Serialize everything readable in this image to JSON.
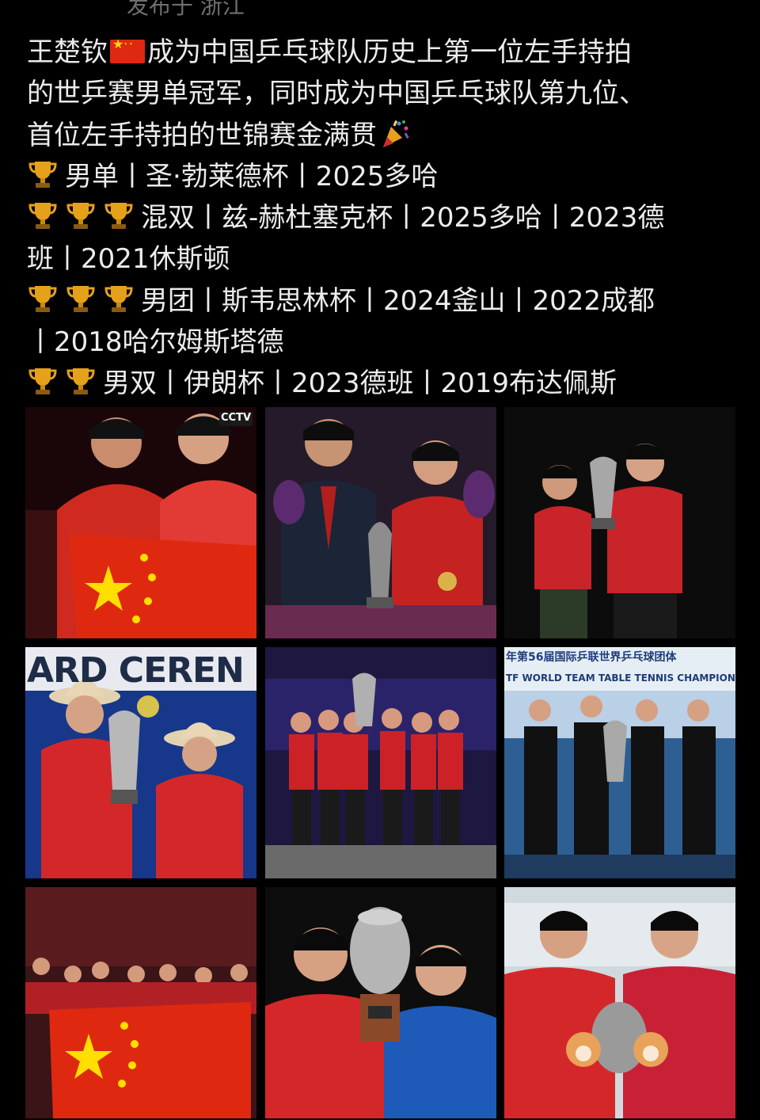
{
  "header": {
    "top_text": "发布于 浙江"
  },
  "post": {
    "line1_a": "王楚钦",
    "line1_b": "成为中国乒乓球队历史上第一位左手持拍",
    "line2": "的世乒赛男单冠军，同时成为中国乒乓球队第九位、",
    "line3": "首位左手持拍的世锦赛金满贯",
    "line4": "男单丨圣·勃莱德杯丨2025多哈",
    "line5": "混双丨兹-赫杜塞克杯丨2025多哈丨2023德",
    "line6": "班丨2021休斯顿",
    "line7": "男团丨斯韦思林杯丨2024釜山丨2022成都",
    "line8": "丨2018哈尔姆斯塔德",
    "line9": "男双丨伊朗杯丨2023德班丨2019布达佩斯"
  },
  "photos": {
    "p1_logo": "CCTV",
    "p4_banner": "ARD CEREN",
    "p6_banner_cn": "年第56届国际乒联世界乒乓球团体",
    "p6_banner_en": "TF WORLD TEAM TABLE TENNIS CHAMPIONS"
  },
  "colors": {
    "background": "#000000",
    "text": "#ececec",
    "china_red": "#de2910",
    "gold": "#e6a11a"
  },
  "icons": [
    "china-flag-icon",
    "party-popper-icon",
    "trophy-icon"
  ]
}
